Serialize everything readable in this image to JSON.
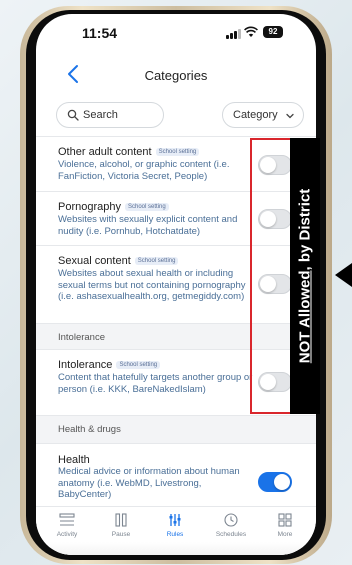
{
  "status_bar": {
    "time": "11:54",
    "battery": "92"
  },
  "nav": {
    "title": "Categories"
  },
  "filters": {
    "search_label": "Search",
    "category_label": "Category"
  },
  "rows": [
    {
      "title": "Other adult content",
      "badge": "School setting",
      "description": "Violence, alcohol, or graphic content (i.e. FanFiction, Victoria Secret, People)",
      "enabled": false
    },
    {
      "title": "Pornography",
      "badge": "School setting",
      "description": "Websites with sexually explicit content and nudity (i.e. Pornhub, Hotchatdate)",
      "enabled": false
    },
    {
      "title": "Sexual content",
      "badge": "School setting",
      "description": "Websites about sexual health or including sexual terms but not containing pornography (i.e. ashasexualhealth.org, getmegiddy.com)",
      "enabled": false
    },
    {
      "title": "Intolerance",
      "badge": "School setting",
      "description": "Content that hatefully targets another group or person (i.e. KKK, BareNakedIslam)",
      "enabled": false
    },
    {
      "title": "Health",
      "badge": "",
      "description": "Medical advice or information about human anatomy (i.e. WebMD, Livestrong, BabyCenter)",
      "enabled": true
    }
  ],
  "sections": {
    "intolerance": "Intolerance",
    "health": "Health & drugs"
  },
  "annotation": {
    "text_underlined": "NOT Allowed",
    "text_rest": ", by District"
  },
  "tabs": [
    {
      "label": "Activity",
      "icon": "activity-icon"
    },
    {
      "label": "Pause",
      "icon": "pause-icon"
    },
    {
      "label": "Rules",
      "icon": "rules-icon",
      "active": true
    },
    {
      "label": "Schedules",
      "icon": "clock-icon"
    },
    {
      "label": "More",
      "icon": "grid-icon"
    }
  ],
  "colors": {
    "accent": "#1a73e8",
    "link_text": "#4a6f97",
    "annotation_red": "#d9262c",
    "banner": "#000000"
  }
}
